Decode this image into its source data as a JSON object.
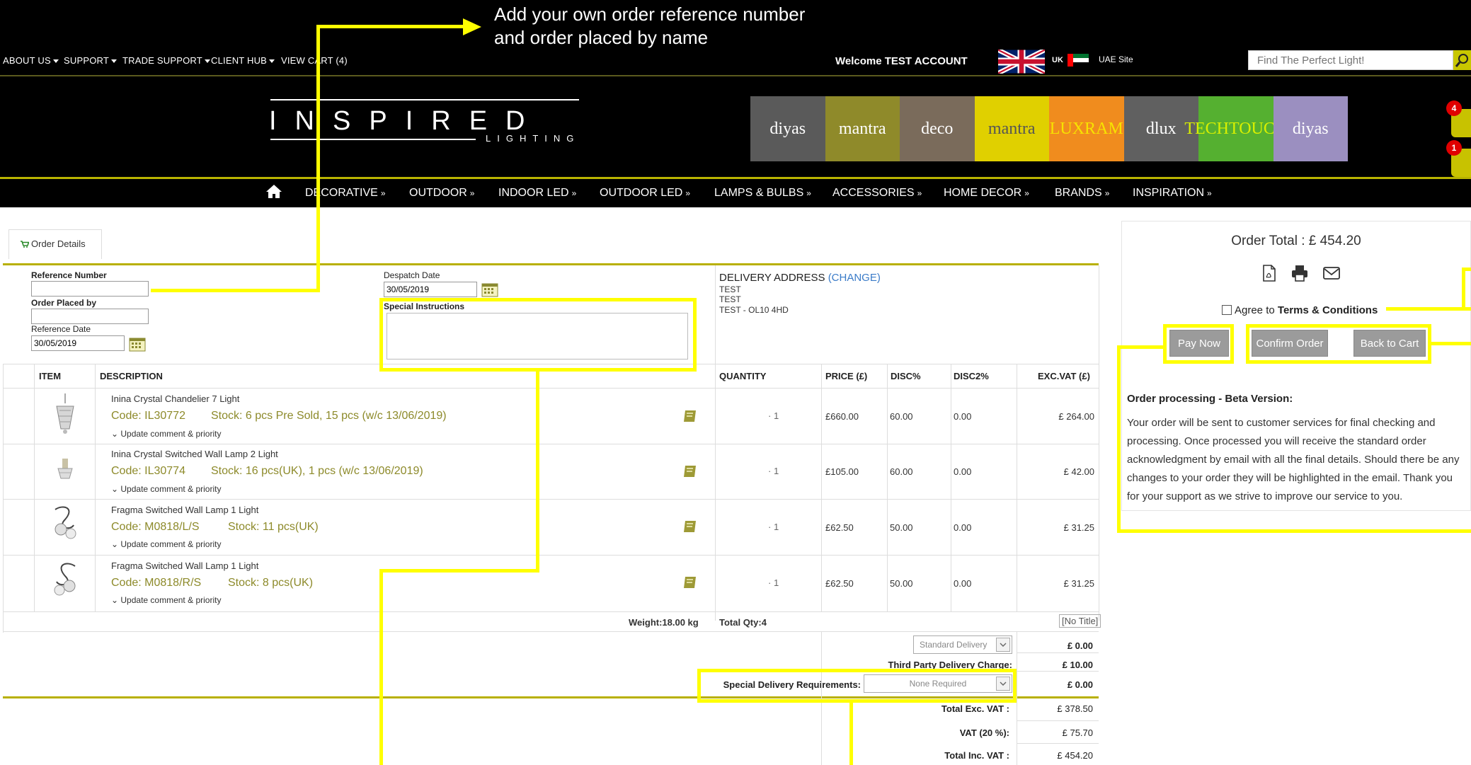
{
  "annotation": {
    "line1": "Add your own order reference number",
    "line2": "and order placed by name"
  },
  "topnav": {
    "about": "ABOUT US",
    "support": "SUPPORT",
    "trade_support": "TRADE SUPPORT",
    "client_hub": "CLIENT HUB",
    "view_cart": "VIEW CART (4)",
    "welcome": "Welcome TEST ACCOUNT",
    "uk_label": "UK",
    "uae_label": "UAE Site",
    "search_placeholder": "Find The Perfect Light!"
  },
  "logo": {
    "word": "INSPIRED",
    "sub": "LIGHTING"
  },
  "brands": [
    {
      "name": "diyas",
      "bg": "#5a5a5a",
      "fg": "#ffffff"
    },
    {
      "name": "mantra",
      "bg": "#8f8a2a",
      "fg": "#ffffff"
    },
    {
      "name": "deco",
      "bg": "#7a6b5b",
      "fg": "#ffffff"
    },
    {
      "name": "mantra",
      "bg": "#e0d000",
      "fg": "#555555"
    },
    {
      "name": "LUXRAM",
      "bg": "#f08c1e",
      "fg": "#f7e200"
    },
    {
      "name": "dlux",
      "bg": "#606060",
      "fg": "#ffffff"
    },
    {
      "name": "TECHTOUCH",
      "bg": "#55b030",
      "fg": "#d8f000"
    },
    {
      "name": "diyas",
      "bg": "#9b8fc0",
      "fg": "#ffffff"
    }
  ],
  "badges": {
    "cart_count": "4",
    "wish_count": "1"
  },
  "mainnav": {
    "decorative": "DECORATIVE",
    "outdoor": "OUTDOOR",
    "indoor_led": "INDOOR LED",
    "outdoor_led": "OUTDOOR LED",
    "lamps": "LAMPS & BULBS",
    "accessories": "ACCESSORIES",
    "home_decor": "HOME DECOR",
    "brands": "BRANDS",
    "inspiration": "INSPIRATION",
    "chevron": "»"
  },
  "order_tab": "Order Details",
  "form": {
    "ref_label": "Reference Number",
    "ref_value": "",
    "placed_label": "Order Placed by",
    "placed_value": "",
    "ref_date_label": "Reference Date",
    "ref_date_value": "30/05/2019",
    "despatch_label": "Despatch Date",
    "despatch_value": "30/05/2019",
    "special_label": "Special Instructions"
  },
  "delivery": {
    "title": "DELIVERY ADDRESS",
    "change": "(CHANGE)",
    "line1": "TEST",
    "line2": "TEST",
    "line3": "TEST - OL10 4HD"
  },
  "table": {
    "headers": {
      "item": "ITEM",
      "description": "DESCRIPTION",
      "quantity": "QUANTITY",
      "price": "PRICE (£)",
      "disc": "DISC%",
      "disc2": "DISC2%",
      "excvat": "EXC.VAT (£)"
    },
    "update_label": "Update comment & priority",
    "rows": [
      {
        "title": "Inina Crystal Chandelier 7 Light",
        "code": "Code: IL30772",
        "stock": "Stock: 6 pcs Pre Sold, 15 pcs (w/c 13/06/2019)",
        "qty": "1",
        "price": "£660.00",
        "disc": "60.00",
        "disc2": "0.00",
        "total": "£ 264.00"
      },
      {
        "title": "Inina Crystal Switched Wall Lamp 2 Light",
        "code": "Code: IL30774",
        "stock": "Stock: 16 pcs(UK), 1 pcs (w/c 13/06/2019)",
        "qty": "1",
        "price": "£105.00",
        "disc": "60.00",
        "disc2": "0.00",
        "total": "£ 42.00"
      },
      {
        "title": "Fragma Switched Wall Lamp 1 Light",
        "code": "Code: M0818/L/S",
        "stock": "Stock: 11 pcs(UK)",
        "qty": "1",
        "price": "£62.50",
        "disc": "50.00",
        "disc2": "0.00",
        "total": "£ 31.25"
      },
      {
        "title": "Fragma Switched Wall Lamp 1 Light",
        "code": "Code: M0818/R/S",
        "stock": "Stock: 8 pcs(UK)",
        "qty": "1",
        "price": "£62.50",
        "disc": "50.00",
        "disc2": "0.00",
        "total": "£ 31.25"
      }
    ],
    "weight": "Weight:18.00 kg",
    "total_qty": "Total Qty:4",
    "no_title": "[No Title]"
  },
  "summary": {
    "delivery_option": "Standard Delivery",
    "delivery_val": "£ 0.00",
    "third_party_label": "Third Party Delivery Charge:",
    "third_party_val": "£ 10.00",
    "special_req_label": "Special Delivery Requirements:",
    "special_req_option": "None Required",
    "special_req_val": "£ 0.00",
    "total_exc_label": "Total Exc. VAT :",
    "total_exc_val": "£ 378.50",
    "vat_label": "VAT (20 %):",
    "vat_val": "£ 75.70",
    "total_inc_label": "Total Inc. VAT :",
    "total_inc_val": "£ 454.20"
  },
  "panel": {
    "order_total": "Order Total : £ 454.20",
    "agree": "Agree to",
    "terms": "Terms & Conditions",
    "pay_now": "Pay Now",
    "confirm": "Confirm Order",
    "back": "Back to Cart",
    "proc_title": "Order processing - Beta Version:",
    "proc_text": "Your order will be sent to customer services for final checking and processing. Once processed you will receive the standard order acknowledgment by email with all the final details. Should there be any changes to your order they will be highlighted in the email. Thank you for your support as we strive to improve our service to you."
  },
  "colors": {
    "accent_yellow": "#ffff00",
    "brand_olive": "#b8b000",
    "code_text": "#8d8a2a",
    "link_blue": "#3a7bc8"
  }
}
